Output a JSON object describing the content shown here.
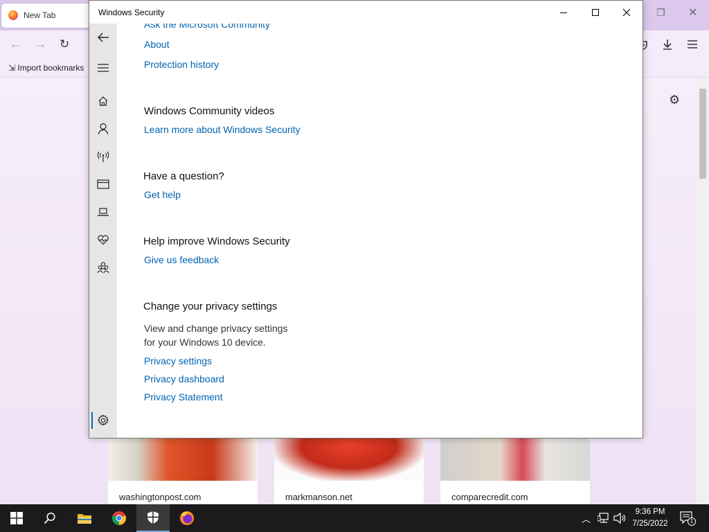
{
  "browser": {
    "tab_title": "New Tab",
    "import_bookmarks": "Import bookmarks",
    "tiles": [
      {
        "label": "washingtonpost.com"
      },
      {
        "label": "markmanson.net"
      },
      {
        "label": "comparecredit.com"
      }
    ]
  },
  "window": {
    "title": "Windows Security"
  },
  "content": {
    "links_top": [
      "Ask the Microsoft Community",
      "About",
      "Protection history"
    ],
    "community_heading": "Windows Community videos",
    "community_link": "Learn more about Windows Security",
    "question_heading": "Have a question?",
    "question_link": "Get help",
    "improve_heading": "Help improve Windows Security",
    "improve_link": "Give us feedback",
    "privacy_heading": "Change your privacy settings",
    "privacy_desc_line1": "View and change privacy settings",
    "privacy_desc_line2": "for your Windows 10 device.",
    "privacy_links": [
      "Privacy settings",
      "Privacy dashboard",
      "Privacy Statement"
    ]
  },
  "taskbar": {
    "time": "9:36 PM",
    "date": "7/25/2022",
    "notification_count": "1"
  },
  "colors": {
    "link": "#0063b1",
    "nav_bg": "#e6e6e6",
    "accent": "#0067b8"
  }
}
